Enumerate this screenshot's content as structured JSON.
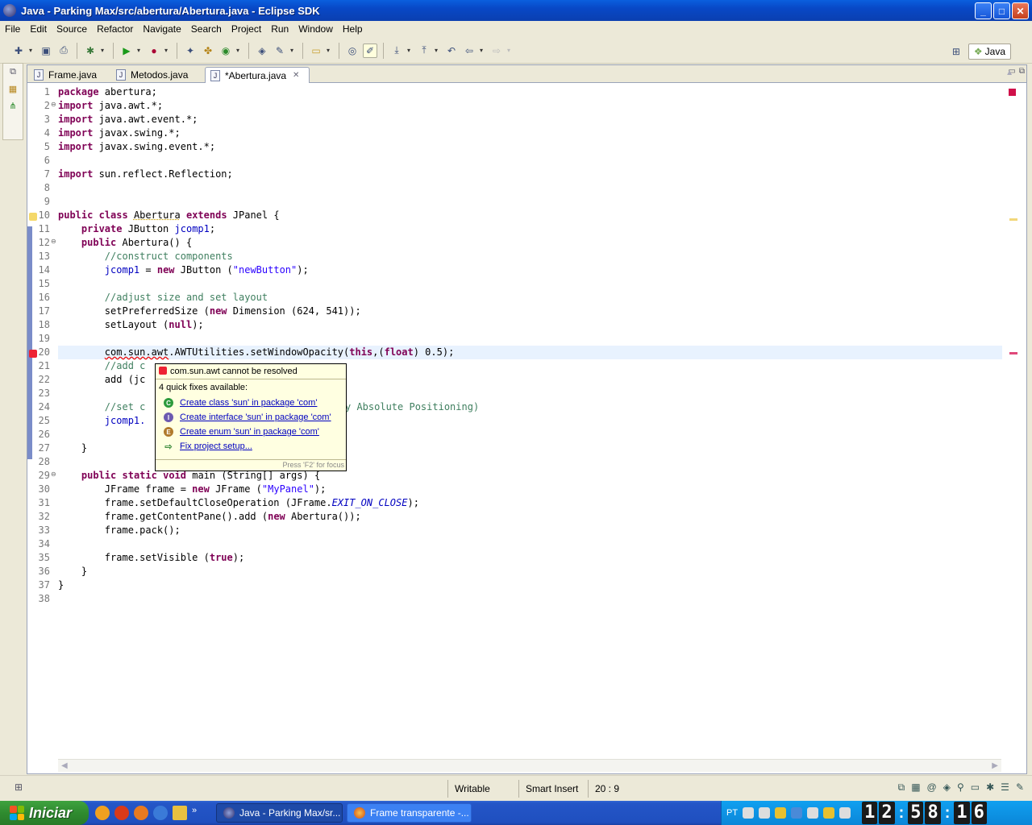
{
  "window": {
    "title": "Java - Parking Max/src/abertura/Abertura.java - Eclipse SDK",
    "min": "_",
    "max": "□",
    "close": "✕"
  },
  "menu": [
    "File",
    "Edit",
    "Source",
    "Refactor",
    "Navigate",
    "Search",
    "Project",
    "Run",
    "Window",
    "Help"
  ],
  "perspective": {
    "label": "Java",
    "open_icon": "open-perspective-icon"
  },
  "tabs": [
    {
      "label": "Frame.java",
      "active": false
    },
    {
      "label": "Metodos.java",
      "active": false
    },
    {
      "label": "*Abertura.java",
      "active": true
    }
  ],
  "code_lines": [
    "1",
    "2",
    "3",
    "4",
    "5",
    "6",
    "7",
    "8",
    "9",
    "10",
    "11",
    "12",
    "13",
    "14",
    "15",
    "16",
    "17",
    "18",
    "19",
    "20",
    "21",
    "22",
    "23",
    "24",
    "25",
    "26",
    "27",
    "28",
    "29",
    "30",
    "31",
    "32",
    "33",
    "34",
    "35",
    "36",
    "37",
    "38"
  ],
  "code": {
    "l1_kw": "package",
    "l1_rest": " abertura;",
    "l2_kw": "import",
    "l2_rest": " java.awt.*;",
    "l3_kw": "import",
    "l3_rest": " java.awt.event.*;",
    "l4_kw": "import",
    "l4_rest": " javax.swing.*;",
    "l5_kw": "import",
    "l5_rest": " javax.swing.event.*;",
    "l7_kw": "import",
    "l7_rest": " sun.reflect.Reflection;",
    "l10_kw1": "public",
    "l10_kw2": "class",
    "l10_name": "Abertura",
    "l10_kw3": "extends",
    "l10_rest": " JPanel {",
    "l11_kw": "private",
    "l11_type": " JButton ",
    "l11_field": "jcomp1",
    "l11_end": ";",
    "l12_kw": "public",
    "l12_rest": " Abertura() {",
    "l13_cm": "//construct components",
    "l14_field": "jcomp1",
    "l14_mid": " = ",
    "l14_kw": "new",
    "l14_call": " JButton (",
    "l14_str": "\"newButton\"",
    "l14_end": ");",
    "l16_cm": "//adjust size and set layout",
    "l17_a": "setPreferredSize (",
    "l17_kw": "new",
    "l17_b": " Dimension (624, 541));",
    "l18_a": "setLayout (",
    "l18_kw": "null",
    "l18_b": ");",
    "l20_err": "com.sun.awt",
    "l20_a": ".AWTUtilities.setWindowOpacity(",
    "l20_kw": "this",
    "l20_b": ",(",
    "l20_kw2": "float",
    "l20_c": ") 0.5);",
    "l21_cm": "//add c",
    "l22_a": "add (jc",
    "l24_cm": "//set c",
    "l24_cm2": "y Absolute Positioning)",
    "l25_field": "jcomp1.",
    "l27": "}",
    "l29_kw1": "public",
    "l29_kw2": "static",
    "l29_kw3": "void",
    "l29_rest": " main (String[] args) {",
    "l30_a": "JFrame frame = ",
    "l30_kw": "new",
    "l30_b": " JFrame (",
    "l30_str": "\"MyPanel\"",
    "l30_c": ");",
    "l31_a": "frame.setDefaultCloseOperation (JFrame.",
    "l31_sf": "EXIT_ON_CLOSE",
    "l31_b": ");",
    "l32_a": "frame.getContentPane().add (",
    "l32_kw": "new",
    "l32_b": " Abertura());",
    "l33": "frame.pack();",
    "l35_a": "frame.setVisible (",
    "l35_kw": "true",
    "l35_b": ");",
    "l36": "}",
    "l37": "}"
  },
  "quickfix": {
    "error": "com.sun.awt cannot be resolved",
    "count": "4 quick fixes available:",
    "fixes": [
      "Create class 'sun' in package 'com'",
      "Create interface 'sun' in package 'com'",
      "Create enum 'sun' in package 'com'",
      "Fix project setup..."
    ],
    "footer": "Press 'F2' for focus"
  },
  "status": {
    "writable": "Writable",
    "insert": "Smart Insert",
    "position": "20 : 9"
  },
  "taskbar": {
    "start": "Iniciar",
    "tasks": [
      "Java - Parking Max/sr...",
      "Frame transparente -..."
    ],
    "lang": "PT",
    "clock": {
      "h1": "1",
      "h2": "2",
      "m1": "5",
      "m2": "8",
      "s1": "1",
      "s2": "6"
    }
  },
  "colors": {
    "keyword": "#7f0055",
    "comment": "#3f7f5f",
    "string": "#2a00ff",
    "field": "#0000c0",
    "error": "#e00000"
  }
}
